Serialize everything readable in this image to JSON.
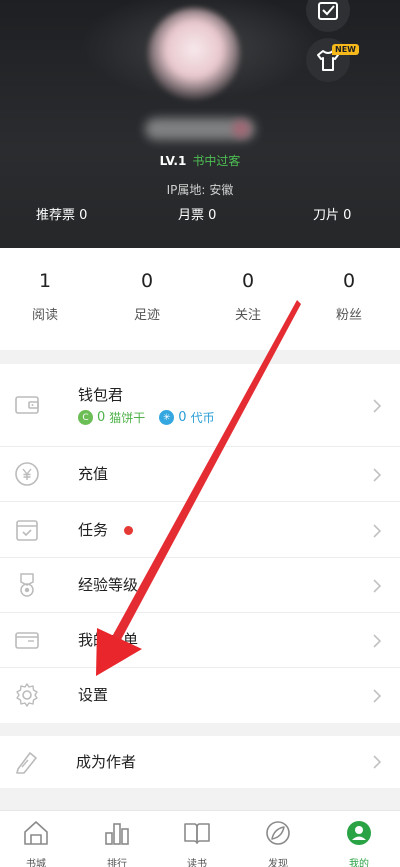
{
  "profile": {
    "level": "LV.1",
    "level_title": "书中过客",
    "ip_label": "IP属地:",
    "ip_location": "安徽",
    "stats": [
      {
        "label": "推荐票",
        "value": "0"
      },
      {
        "label": "月票",
        "value": "0"
      },
      {
        "label": "刀片",
        "value": "0"
      }
    ],
    "new_badge": "NEW"
  },
  "counts": [
    {
      "value": "1",
      "label": "阅读"
    },
    {
      "value": "0",
      "label": "足迹"
    },
    {
      "value": "0",
      "label": "关注"
    },
    {
      "value": "0",
      "label": "粉丝"
    }
  ],
  "menu": {
    "wallet": {
      "label": "钱包君",
      "coins_value": "0",
      "coins_label": "猫饼干",
      "points_value": "0",
      "points_label": "代币"
    },
    "recharge": "充值",
    "tasks": "任务",
    "level": "经验等级",
    "booklist": "我的书单",
    "settings": "设置",
    "author": "成为作者"
  },
  "nav": [
    {
      "label": "书城",
      "icon": "bookstore-icon"
    },
    {
      "label": "排行",
      "icon": "ranking-icon"
    },
    {
      "label": "读书",
      "icon": "book-icon"
    },
    {
      "label": "发现",
      "icon": "discover-icon"
    },
    {
      "label": "我的",
      "icon": "profile-icon",
      "active": true
    }
  ],
  "colors": {
    "accent_green": "#2aa345",
    "arrow_red": "#e8262b",
    "header_bg": "#1d1f22"
  }
}
